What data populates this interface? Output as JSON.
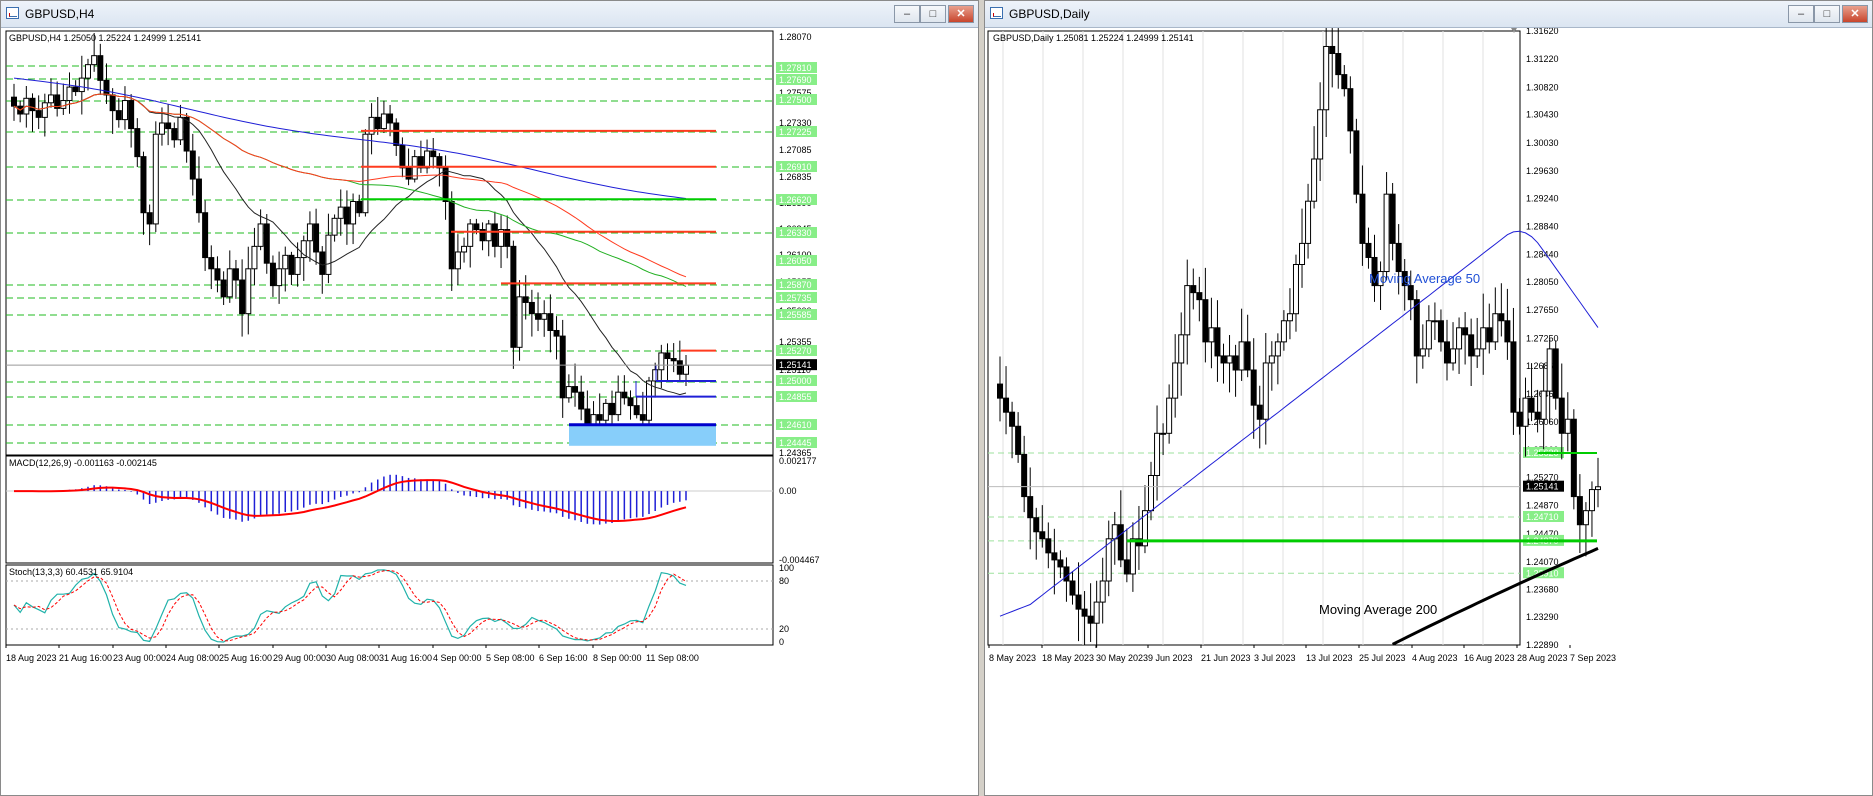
{
  "left": {
    "title": "GBPUSD,H4",
    "info": "GBPUSD,H4  1.25050 1.25224 1.24999 1.25141",
    "current_price": "1.25141",
    "x_labels": [
      "18 Aug 2023",
      "21 Aug 16:00",
      "23 Aug 00:00",
      "24 Aug 08:00",
      "25 Aug 16:00",
      "29 Aug 00:00",
      "30 Aug 08:00",
      "31 Aug 16:00",
      "4 Sep 00:00",
      "5 Sep 08:00",
      "6 Sep 16:00",
      "8 Sep 00:00",
      "11 Sep 08:00"
    ],
    "y_labels": [
      "1.28070",
      "1.27575",
      "1.27330",
      "1.27085",
      "1.26835",
      "1.26590",
      "1.26345",
      "1.26100",
      "1.25855",
      "1.25600",
      "1.25355",
      "1.25110",
      "1.24865",
      "1.24620",
      "1.24365"
    ],
    "level_labels": [
      "1.27810",
      "1.27690",
      "1.27500",
      "1.27225",
      "1.26910",
      "1.26620",
      "1.26330",
      "1.26050",
      "1.25870",
      "1.25735",
      "1.25585",
      "1.25270",
      "1.25000",
      "1.24855",
      "1.24610",
      "1.24445"
    ],
    "macd": {
      "label": "MACD(12,26,9) -0.001163 -0.002145",
      "y_labels": [
        "0.002177",
        "0.00",
        "-0.004467"
      ]
    },
    "stoch": {
      "label": "Stoch(13,3,3) 60.4531 65.9104",
      "y_labels": [
        "100",
        "80",
        "20",
        "0"
      ]
    }
  },
  "right": {
    "title": "GBPUSD,Daily",
    "info": "GBPUSD,Daily  1.25081 1.25224 1.24999 1.25141",
    "current_price": "1.25141",
    "x_labels": [
      "8 May 2023",
      "18 May 2023",
      "30 May 2023",
      "9 Jun 2023",
      "21 Jun 2023",
      "3 Jul 2023",
      "13 Jul 2023",
      "25 Jul 2023",
      "4 Aug 2023",
      "16 Aug 2023",
      "28 Aug 2023",
      "7 Sep 2023"
    ],
    "y_labels": [
      "1.31620",
      "1.31220",
      "1.30820",
      "1.30430",
      "1.30030",
      "1.29630",
      "1.29240",
      "1.28840",
      "1.28440",
      "1.28050",
      "1.27650",
      "1.27250",
      "1.26860",
      "1.26460",
      "1.26060",
      "1.25660",
      "1.25270",
      "1.24870",
      "1.24470",
      "1.24070",
      "1.23680",
      "1.23290",
      "1.22890"
    ],
    "level_labels": [
      "1.25620",
      "1.24710",
      "1.24370",
      "1.23910"
    ],
    "ma50_label": "Moving Average 50",
    "ma200_label": "Moving Average 200"
  },
  "colors": {
    "bull": "#ffffff",
    "bear": "#000000",
    "ma_blue": "#1f1fd6",
    "ma_red": "#ff3b1f",
    "ma_green": "#22b022",
    "level_green": "#00cc00",
    "macd_hist": "#1f1fd6",
    "macd_signal": "#ff0000",
    "stoch_main": "#20b2aa"
  },
  "chart_data": [
    {
      "type": "candlestick",
      "symbol": "GBPUSD",
      "timeframe": "H4",
      "ylim": [
        1.2434,
        1.2812
      ],
      "last": 1.25141,
      "support_resistance": [
        1.2723,
        1.2691,
        1.2662,
        1.2633,
        1.2587,
        1.2527,
        1.25,
        1.2486,
        1.2461
      ],
      "approx_closes": [
        1.2745,
        1.2738,
        1.2752,
        1.2741,
        1.2735,
        1.2748,
        1.2755,
        1.2743,
        1.275,
        1.2762,
        1.2758,
        1.277,
        1.2782,
        1.279,
        1.2768,
        1.2755,
        1.2741,
        1.2733,
        1.275,
        1.2725,
        1.27,
        1.265,
        1.264,
        1.272,
        1.273,
        1.2725,
        1.2715,
        1.2735,
        1.2705,
        1.268,
        1.265,
        1.261,
        1.26,
        1.259,
        1.2575,
        1.26,
        1.259,
        1.256,
        1.26,
        1.262,
        1.264,
        1.2605,
        1.2585,
        1.26,
        1.2612,
        1.2595,
        1.261,
        1.2625,
        1.264,
        1.2615,
        1.2595,
        1.263,
        1.2645,
        1.2655,
        1.264,
        1.266,
        1.265,
        1.272,
        1.2735,
        1.2725,
        1.2738,
        1.273,
        1.271,
        1.269,
        1.268,
        1.27,
        1.269,
        1.2705,
        1.27,
        1.269,
        1.266,
        1.26,
        1.2615,
        1.262,
        1.264,
        1.2635,
        1.2625,
        1.264,
        1.262,
        1.2635,
        1.262,
        1.253,
        1.2575,
        1.257,
        1.256,
        1.2555,
        1.256,
        1.2545,
        1.254,
        1.2485,
        1.2495,
        1.249,
        1.2475,
        1.246,
        1.247,
        1.2465,
        1.248,
        1.247,
        1.249,
        1.2485,
        1.2478,
        1.247,
        1.2465,
        1.25,
        1.251,
        1.2525,
        1.252,
        1.2518,
        1.2506,
        1.2514
      ]
    },
    {
      "type": "line",
      "name": "MACD(12,26,9)",
      "ylim": [
        -0.004467,
        0.002177
      ],
      "macd": -0.001163,
      "signal": -0.002145
    },
    {
      "type": "line",
      "name": "Stoch(13,3,3)",
      "ylim": [
        0,
        100
      ],
      "levels": [
        20,
        80
      ],
      "main": 60.4531,
      "signal": 65.9104
    },
    {
      "type": "candlestick",
      "symbol": "GBPUSD",
      "timeframe": "Daily",
      "ylim": [
        1.2289,
        1.3162
      ],
      "last": 1.25141,
      "support_resistance": [
        1.2562,
        1.2437
      ],
      "approx_closes": [
        1.264,
        1.262,
        1.26,
        1.256,
        1.25,
        1.247,
        1.245,
        1.244,
        1.242,
        1.241,
        1.24,
        1.238,
        1.236,
        1.234,
        1.233,
        1.232,
        1.235,
        1.238,
        1.244,
        1.246,
        1.241,
        1.239,
        1.244,
        1.243,
        1.248,
        1.253,
        1.259,
        1.259,
        1.264,
        1.269,
        1.273,
        1.28,
        1.279,
        1.278,
        1.272,
        1.274,
        1.27,
        1.269,
        1.27,
        1.268,
        1.272,
        1.268,
        1.263,
        1.261,
        1.269,
        1.27,
        1.272,
        1.275,
        1.276,
        1.283,
        1.286,
        1.292,
        1.298,
        1.305,
        1.314,
        1.313,
        1.31,
        1.308,
        1.302,
        1.293,
        1.286,
        1.284,
        1.28,
        1.282,
        1.293,
        1.286,
        1.282,
        1.28,
        1.278,
        1.27,
        1.271,
        1.275,
        1.275,
        1.272,
        1.269,
        1.271,
        1.274,
        1.273,
        1.27,
        1.271,
        1.274,
        1.272,
        1.276,
        1.275,
        1.272,
        1.262,
        1.26,
        1.264,
        1.262,
        1.261,
        1.265,
        1.271,
        1.264,
        1.259,
        1.261,
        1.25,
        1.246,
        1.248,
        1.251,
        1.2514
      ]
    }
  ]
}
